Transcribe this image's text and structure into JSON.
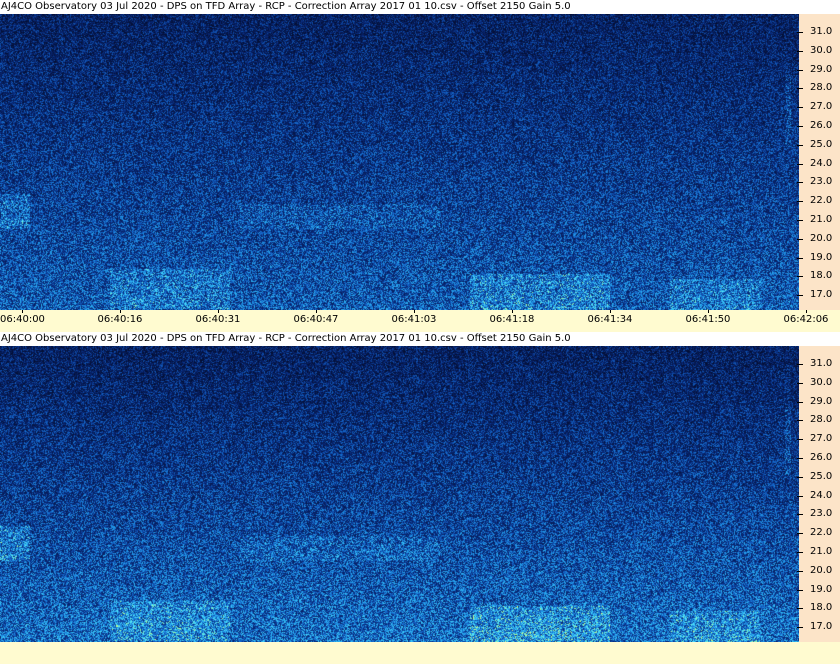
{
  "panels": [
    {
      "title": "AJ4CO Observatory 03 Jul 2020  -  DPS on TFD Array  -  RCP  -  Correction Array 2017 01 10.csv  -  Offset 2150  Gain 5.0",
      "freq_ticks": [
        "31.0",
        "30.0",
        "29.0",
        "28.0",
        "27.0",
        "26.0",
        "25.0",
        "24.0",
        "23.0",
        "22.0",
        "21.0",
        "20.0",
        "19.0",
        "18.0",
        "17.0"
      ]
    },
    {
      "title": "AJ4CO Observatory 03 Jul 2020  -  DPS on TFD Array  -  RCP  -  Correction Array 2017 01 10.csv  -  Offset 2150  Gain 5.0",
      "freq_ticks": [
        "31.0",
        "30.0",
        "29.0",
        "28.0",
        "27.0",
        "26.0",
        "25.0",
        "24.0",
        "23.0",
        "22.0",
        "21.0",
        "20.0",
        "19.0",
        "18.0",
        "17.0"
      ]
    }
  ],
  "time_axis": {
    "labels": [
      "06:40:00",
      "06:40:16",
      "06:40:31",
      "06:40:47",
      "06:41:03",
      "06:41:18",
      "06:41:34",
      "06:41:50",
      "06:42:06"
    ]
  },
  "colors": {
    "background_low": "#06154a",
    "background_mid": "#1060c0",
    "signal_high": "#40e0ff",
    "burst": "#a0ff80",
    "freq_axis_bg": "#fce4c8",
    "time_axis_bg": "#fffbd0"
  }
}
